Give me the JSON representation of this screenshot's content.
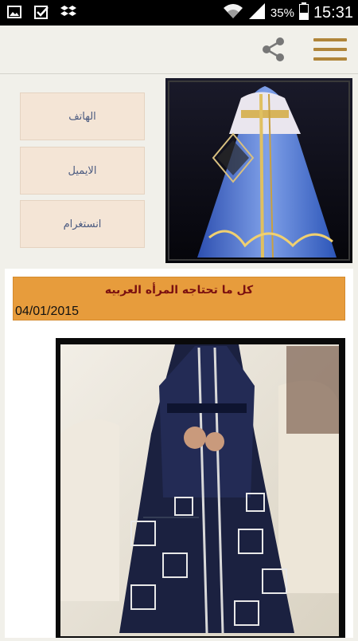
{
  "status_bar": {
    "left_icons": [
      "image-icon",
      "checkbox-icon",
      "dropbox-icon"
    ],
    "right_icons": [
      "wifi-icon",
      "signal-icon",
      "battery-icon"
    ],
    "battery": "35%",
    "time": "15:31"
  },
  "action_bar": {
    "share_icon": "share-icon",
    "menu_icon": "hamburger-menu-icon",
    "accent_color": "#b0853a"
  },
  "contact": {
    "phone": "الهاتف",
    "email": "الايميل",
    "instagram": "انستغرام"
  },
  "post": {
    "title": "كل ما تحتاجه المرأه العربيه",
    "date": "04/01/2015",
    "title_bar_color": "#e79c3c"
  }
}
